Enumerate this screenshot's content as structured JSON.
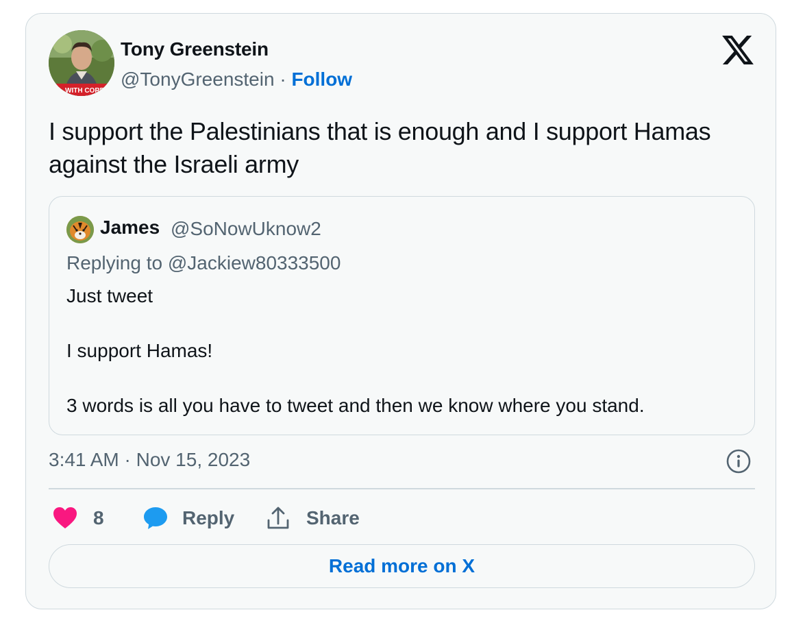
{
  "author": {
    "name": "Tony Greenstein",
    "handle": "@TonyGreenstein",
    "separator": " · ",
    "follow_label": "Follow",
    "avatar_banner_text": "WITH CORB"
  },
  "tweet": {
    "text": "I support the Palestinians that is enough and I support Hamas against the Israeli army",
    "timestamp": "3:41 AM · Nov 15, 2023"
  },
  "quoted": {
    "name": "James",
    "handle": "@SoNowUknow2",
    "replying_to": "Replying to @Jackiew80333500",
    "lines": [
      "Just tweet",
      "I support Hamas!",
      "3 words is all you have to tweet and then we know where you stand."
    ]
  },
  "actions": {
    "like_count": "8",
    "reply_label": "Reply",
    "share_label": "Share"
  },
  "read_more_label": "Read more on X",
  "icons": {
    "brand": "x-logo-icon",
    "info": "info-icon",
    "like": "heart-icon",
    "reply": "speech-bubble-icon",
    "share": "share-upload-icon"
  },
  "colors": {
    "like": "#f91880",
    "reply": "#1d9bf0",
    "link": "#006fd6",
    "secondary_text": "#536471",
    "border": "#cfd9de",
    "card_background": "#f7f9f9"
  }
}
